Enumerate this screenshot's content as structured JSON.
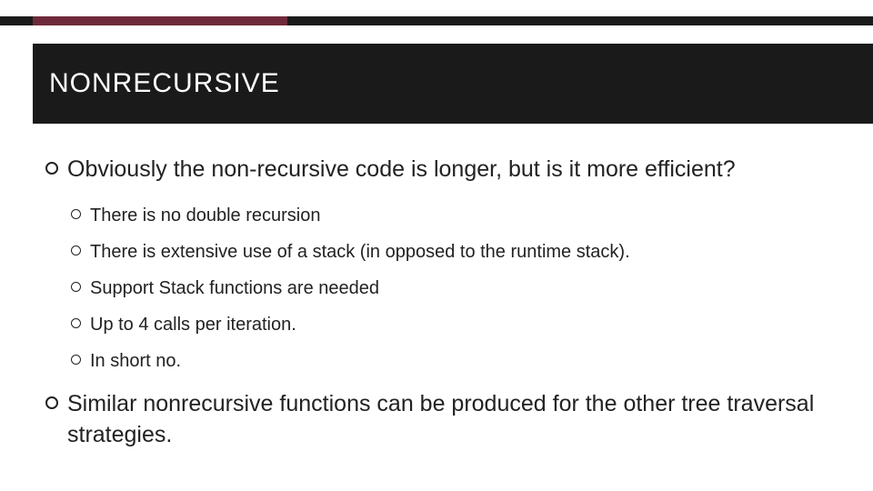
{
  "title": "NONRECURSIVE",
  "bullets": {
    "l1a": "Obviously the non-recursive code is longer, but is it more efficient?",
    "l2a": "There is no double recursion",
    "l2b": "There is extensive use of a stack (in opposed to the runtime stack).",
    "l2c": "Support Stack functions are needed",
    "l2d": "Up to 4 calls per iteration.",
    "l2e": "In short no.",
    "l1b": "Similar nonrecursive functions can be produced for the other tree traversal strategies."
  }
}
